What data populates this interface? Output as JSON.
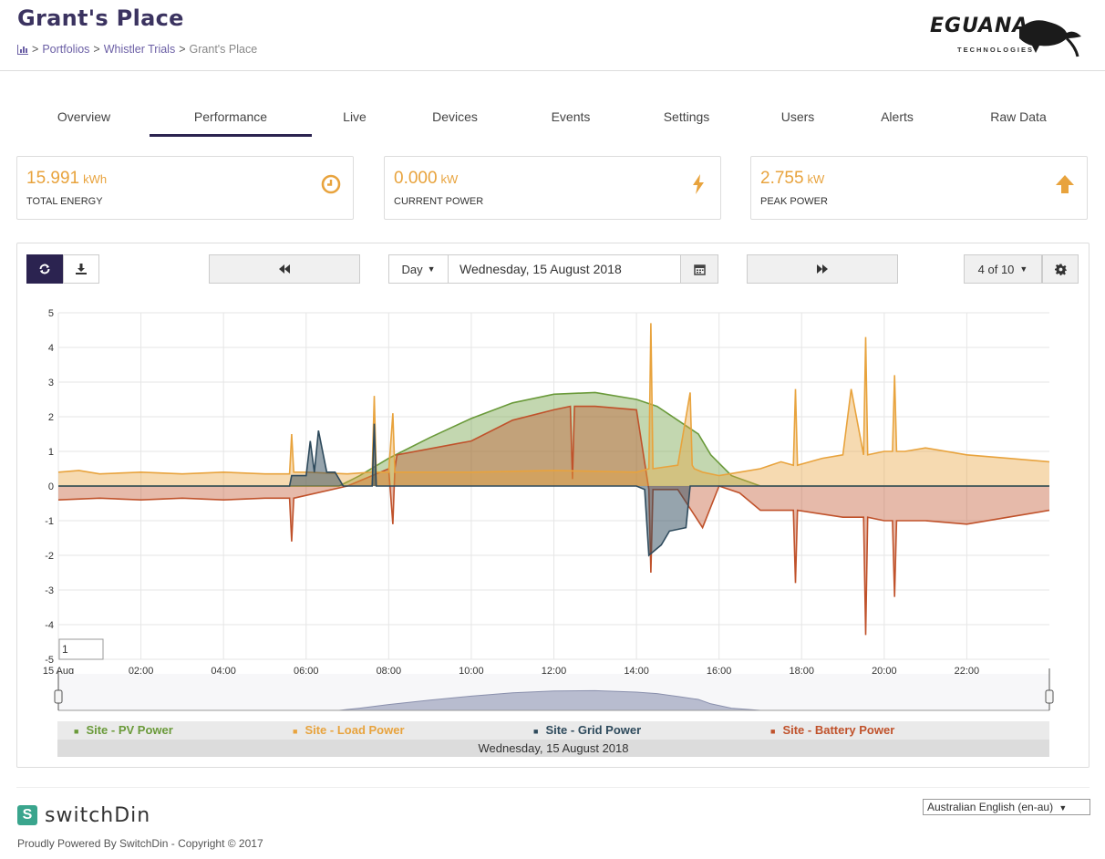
{
  "header": {
    "title": "Grant's Place",
    "breadcrumb": [
      "Portfolios",
      "Whistler Trials",
      "Grant's Place"
    ],
    "logo_text": "EGUANA",
    "logo_sub": "TECHNOLOGIES"
  },
  "tabs": [
    "Overview",
    "Performance",
    "Live",
    "Devices",
    "Events",
    "Settings",
    "Users",
    "Alerts",
    "Raw Data"
  ],
  "active_tab": "Performance",
  "kpis": [
    {
      "value": "15.991",
      "unit": "kWh",
      "label": "TOTAL ENERGY",
      "icon": "clock-icon"
    },
    {
      "value": "0.000",
      "unit": "kW",
      "label": "CURRENT POWER",
      "icon": "bolt-icon"
    },
    {
      "value": "2.755",
      "unit": "kW",
      "label": "PEAK POWER",
      "icon": "arrow-up-icon"
    }
  ],
  "toolbar": {
    "refresh_icon": "refresh-icon",
    "download_icon": "download-icon",
    "prev_icon": "fast-backward-icon",
    "period": "Day",
    "date": "Wednesday, 15 August 2018",
    "calendar_icon": "calendar-icon",
    "next_icon": "fast-forward-icon",
    "page": "4 of 10",
    "settings_icon": "gear-icon",
    "zoom_input": "1"
  },
  "colors": {
    "pv": "#6a9a3a",
    "load": "#e8a33d",
    "grid": "#2e4a5c",
    "battery": "#c0522b",
    "brand": "#2b2350"
  },
  "chart_data": {
    "type": "area",
    "y_ticks": [
      "5",
      "4",
      "3",
      "2",
      "1",
      "0",
      "-1",
      "-2",
      "-3",
      "-4",
      "-5"
    ],
    "x_ticks": [
      "15 Aug",
      "02:00",
      "04:00",
      "06:00",
      "08:00",
      "10:00",
      "12:00",
      "14:00",
      "16:00",
      "18:00",
      "20:00",
      "22:00"
    ],
    "xlim": [
      0,
      24
    ],
    "ylim": [
      -5,
      5
    ],
    "grid": true,
    "series": [
      {
        "name": "Site - PV Power",
        "x": [
          0,
          6.8,
          7.3,
          8,
          9,
          10,
          11,
          12,
          13,
          14,
          14.5,
          15,
          15.5,
          15.8,
          16.3,
          17,
          24
        ],
        "values": [
          0,
          0,
          0.3,
          0.8,
          1.4,
          1.95,
          2.4,
          2.65,
          2.7,
          2.5,
          2.3,
          1.9,
          1.5,
          0.9,
          0.3,
          0,
          0
        ]
      },
      {
        "name": "Site - Load Power",
        "x": [
          0,
          0.5,
          1,
          2,
          3,
          4,
          5,
          5.6,
          5.65,
          5.7,
          6,
          7,
          7.6,
          7.65,
          7.7,
          8,
          8.1,
          8.15,
          8.2,
          10,
          12,
          14,
          14.3,
          14.35,
          14.4,
          15,
          15.3,
          15.35,
          15.4,
          15.6,
          16,
          16.5,
          17,
          17.5,
          17.8,
          17.85,
          17.9,
          18.5,
          19,
          19.2,
          19.5,
          19.55,
          19.6,
          20,
          20.2,
          20.25,
          20.3,
          20.5,
          21,
          22,
          23,
          24
        ],
        "values": [
          0.4,
          0.45,
          0.35,
          0.4,
          0.35,
          0.4,
          0.35,
          0.35,
          1.5,
          0.4,
          0.4,
          0.35,
          0.4,
          2.6,
          0.4,
          0.4,
          2.1,
          0.4,
          0.4,
          0.4,
          0.45,
          0.4,
          0.5,
          4.7,
          0.5,
          0.6,
          2.7,
          0.6,
          0.5,
          0.4,
          0.3,
          0.4,
          0.5,
          0.7,
          0.6,
          2.8,
          0.6,
          0.8,
          0.9,
          2.8,
          0.9,
          4.3,
          0.9,
          1.0,
          1.0,
          3.2,
          1.0,
          1.0,
          1.1,
          0.9,
          0.8,
          0.7
        ]
      },
      {
        "name": "Site - Grid Power",
        "x": [
          0,
          5.6,
          5.65,
          6,
          6.1,
          6.2,
          6.3,
          6.5,
          6.7,
          6.9,
          7.6,
          7.65,
          7.7,
          14,
          14.2,
          14.3,
          14.6,
          14.8,
          15.2,
          15.3,
          16,
          24
        ],
        "values": [
          0,
          0,
          0.3,
          0.3,
          1.3,
          0.4,
          1.6,
          0.4,
          0.4,
          0,
          0,
          1.8,
          0,
          0,
          -0.1,
          -2.0,
          -1.7,
          -1.3,
          -1.2,
          0,
          0,
          0
        ]
      },
      {
        "name": "Site - Battery Power",
        "x": [
          0,
          1,
          2,
          3,
          4,
          5,
          5.6,
          5.65,
          5.7,
          7,
          8,
          8.1,
          8.15,
          8.2,
          10,
          11,
          12,
          12.4,
          12.45,
          12.5,
          13,
          14,
          14.3,
          14.35,
          14.4,
          15,
          15.6,
          16,
          16.5,
          17,
          17.8,
          17.85,
          17.9,
          19,
          19.5,
          19.55,
          19.6,
          20,
          20.2,
          20.25,
          20.3,
          21,
          22,
          23,
          24
        ],
        "values": [
          -0.4,
          -0.35,
          -0.4,
          -0.35,
          -0.4,
          -0.35,
          -0.35,
          -1.6,
          -0.35,
          0,
          0.5,
          -1.1,
          0.5,
          0.9,
          1.3,
          1.9,
          2.2,
          2.3,
          0.2,
          2.3,
          2.3,
          2.2,
          -0.1,
          -2.5,
          -0.1,
          -0.1,
          -1.2,
          0,
          -0.2,
          -0.7,
          -0.7,
          -2.8,
          -0.7,
          -0.9,
          -0.9,
          -4.3,
          -0.9,
          -1.0,
          -1.0,
          -3.2,
          -1.0,
          -1.0,
          -1.1,
          -0.9,
          -0.7
        ]
      }
    ],
    "legend_position": "bottom",
    "legend": [
      "Site - PV Power",
      "Site - Load Power",
      "Site - Grid Power",
      "Site - Battery Power"
    ],
    "date_label": "Wednesday, 15 August 2018"
  },
  "footer": {
    "brand": "switchDin",
    "powered_by": "Proudly Powered By SwitchDin - Copyright © 2017",
    "language": "Australian English (en-au)"
  }
}
